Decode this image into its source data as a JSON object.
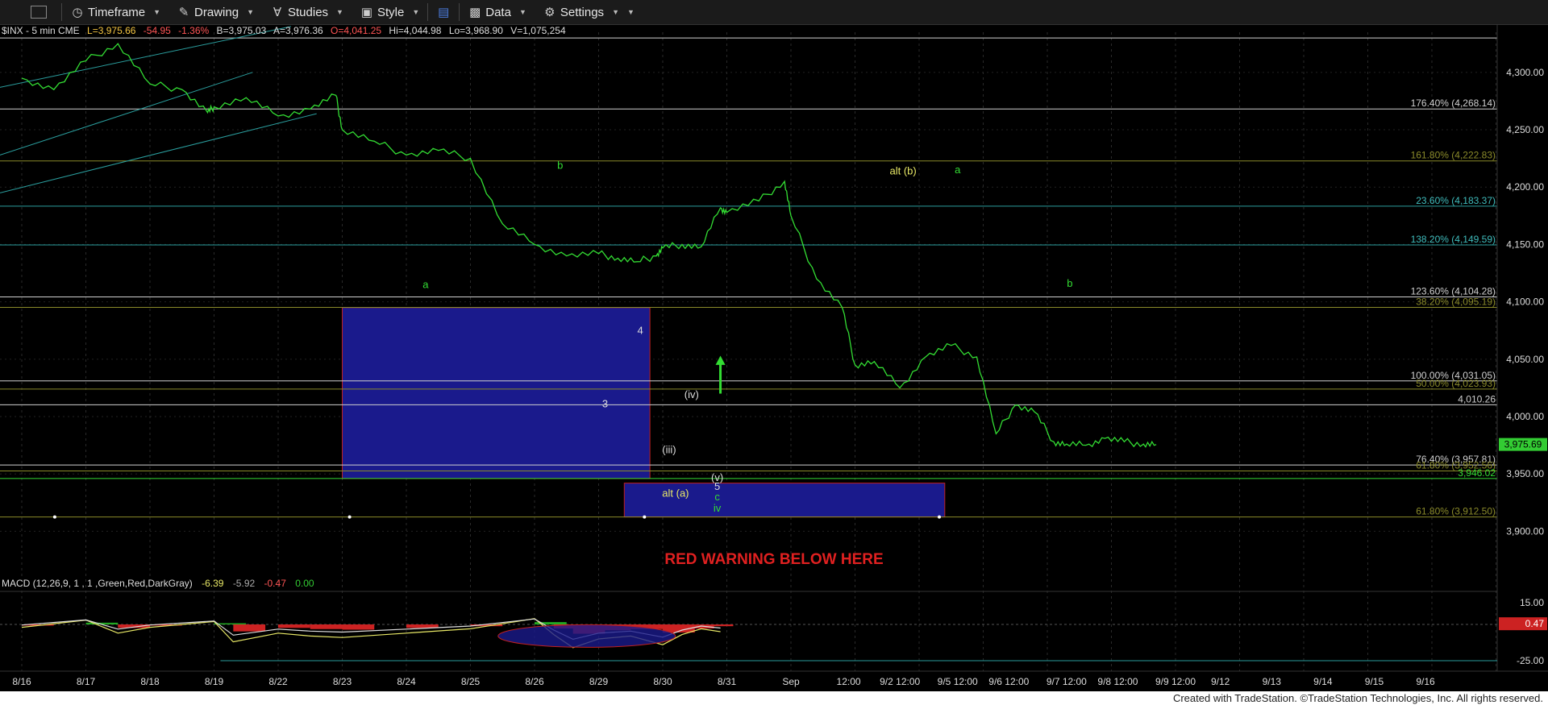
{
  "toolbar": {
    "items": [
      {
        "label": "Timeframe",
        "icon": "clock-icon"
      },
      {
        "label": "Drawing",
        "icon": "pencil-icon"
      },
      {
        "label": "Studies",
        "icon": "studies-icon"
      },
      {
        "label": "Style",
        "icon": "style-icon"
      },
      {
        "label": "Data",
        "icon": "data-icon"
      },
      {
        "label": "Settings",
        "icon": "gear-icon"
      }
    ]
  },
  "header": {
    "symbol": "$INX - 5 min  CME",
    "last": "L=3,975.66",
    "change": "-54.95",
    "pct": "-1.36%",
    "bid": "B=3,975.03",
    "ask": "A=3,976.36",
    "open": "O=4,041.25",
    "hi": "Hi=4,044.98",
    "lo": "Lo=3,968.90",
    "volume": "V=1,075,254"
  },
  "macd_header": {
    "name": "MACD (12,26,9, 1 , 1 ,Green,Red,DarkGray)",
    "v1": "-6.39",
    "v2": "-5.92",
    "v3": "-0.47",
    "v4": "0.00"
  },
  "colors": {
    "price": "#33dd33",
    "teal": "#2a9d9d",
    "white_level": "#cfcfcf",
    "olive": "#8a8a2a",
    "box": "#1a1a8c",
    "warning": "#e02020",
    "last_badge": "#33cc33",
    "macd_badge": "#cc2222"
  },
  "chart_data": {
    "type": "line",
    "title": "",
    "xlabel": "",
    "ylabel": "",
    "ylim": [
      3875,
      4335
    ],
    "x_ticks": [
      "8/16",
      "8/17",
      "8/18",
      "8/19",
      "8/22",
      "8/23",
      "8/24",
      "8/25",
      "8/26",
      "8/29",
      "8/30",
      "8/31",
      "Sep",
      "12:00",
      "9/2 12:00",
      "9/5 12:00",
      "9/6 12:00",
      "9/7 12:00",
      "9/8 12:00",
      "9/9 12:00",
      "9/12",
      "9/13",
      "9/14",
      "9/15",
      "9/16"
    ],
    "y_ticks": [
      "4,300.00",
      "4,250.00",
      "4,200.00",
      "4,150.00",
      "4,100.00",
      "4,050.00",
      "4,000.00",
      "3,950.00",
      "3,900.00"
    ],
    "series": [
      {
        "name": "$INX",
        "x": [
          0,
          0.5,
          1,
          1.5,
          2,
          2.5,
          2.9,
          3,
          3.5,
          4,
          4.5,
          4.9,
          5,
          5.5,
          6,
          6.5,
          7,
          7.5,
          8,
          8.5,
          9,
          9.3,
          9.6,
          9.9,
          10,
          10.3,
          10.6,
          10.9,
          11,
          11.5,
          11.9,
          12,
          12.4,
          12.8,
          13,
          13.3,
          13.7,
          14.1,
          14.5,
          14.9,
          15.2,
          15.5,
          15.8,
          16.1,
          16.3,
          16.6,
          16.9,
          17.2,
          17.5,
          17.7
        ],
        "y": [
          4295,
          4285,
          4310,
          4325,
          4290,
          4285,
          4265,
          4270,
          4278,
          4262,
          4268,
          4280,
          4250,
          4240,
          4228,
          4232,
          4225,
          4168,
          4150,
          4140,
          4142,
          4138,
          4135,
          4140,
          4147,
          4150,
          4148,
          4182,
          4178,
          4188,
          4205,
          4175,
          4120,
          4095,
          4045,
          4048,
          4025,
          4052,
          4062,
          4052,
          3985,
          4010,
          4004,
          3978,
          3976,
          3975,
          3981,
          3978,
          3976,
          3975.66
        ]
      }
    ],
    "levels": [
      {
        "label": "176.40% (4,268.14)",
        "value": 4268.14,
        "color": "white"
      },
      {
        "label": "161.80% (4,222.83)",
        "value": 4222.83,
        "color": "olive"
      },
      {
        "label": "23.60% (4,183.37)",
        "value": 4183.37,
        "color": "teal"
      },
      {
        "label": "138.20% (4,149.59)",
        "value": 4149.59,
        "color": "teal"
      },
      {
        "label": "123.60% (4,104.28)",
        "value": 4104.28,
        "color": "white"
      },
      {
        "label": "38.20% (4,095.19)",
        "value": 4095.19,
        "color": "olive"
      },
      {
        "label": "100.00% (4,031.05)",
        "value": 4031.05,
        "color": "white"
      },
      {
        "label": "50.00% (4,023.93)",
        "value": 4023.93,
        "color": "olive"
      },
      {
        "label": "4,010.26",
        "value": 4010.26,
        "color": "white"
      },
      {
        "label": "76.40% (3,957.81)",
        "value": 3957.81,
        "color": "white"
      },
      {
        "label": "61.80% (3,952.56)",
        "value": 3952.56,
        "color": "olive"
      },
      {
        "label": "3,946.02",
        "value": 3946.02,
        "color": "green"
      },
      {
        "label": "61.80% (3,912.50)",
        "value": 3912.5,
        "color": "olive"
      }
    ],
    "last_price": "3,975.69",
    "annotations": [
      {
        "text": "a",
        "x": 6.3,
        "y": 4112,
        "color": "green"
      },
      {
        "text": "b",
        "x": 8.4,
        "y": 4216,
        "color": "green"
      },
      {
        "text": "3",
        "x": 9.1,
        "y": 4008,
        "color": "white"
      },
      {
        "text": "4",
        "x": 9.65,
        "y": 4072,
        "color": "white"
      },
      {
        "text": "(iv)",
        "x": 10.45,
        "y": 4016,
        "color": "white"
      },
      {
        "text": "(iii)",
        "x": 10.1,
        "y": 3968,
        "color": "white"
      },
      {
        "text": "(v)",
        "x": 10.85,
        "y": 3944,
        "color": "white"
      },
      {
        "text": "5",
        "x": 10.85,
        "y": 3936,
        "color": "white"
      },
      {
        "text": "c",
        "x": 10.85,
        "y": 3927,
        "color": "green"
      },
      {
        "text": "iv",
        "x": 10.85,
        "y": 3917,
        "color": "green"
      },
      {
        "text": "alt (a)",
        "x": 10.2,
        "y": 3930,
        "color": "yellow"
      },
      {
        "text": "alt (b)",
        "x": 13.75,
        "y": 4211,
        "color": "yellow"
      },
      {
        "text": "a",
        "x": 14.6,
        "y": 4212,
        "color": "green"
      },
      {
        "text": "b",
        "x": 16.35,
        "y": 4113,
        "color": "green"
      }
    ],
    "warning_text": "RED WARNING BELOW HERE",
    "macd": {
      "y_ticks": [
        "15.00",
        "0.47",
        "-25.00"
      ],
      "macd_x": [
        0,
        1,
        1.5,
        2,
        3,
        3.3,
        4,
        4.5,
        5,
        6,
        7,
        8,
        8.3,
        8.6,
        9,
        9.5,
        10,
        10.3,
        10.6,
        10.9
      ],
      "macd_y": [
        -2,
        3,
        -6,
        -2,
        2,
        -12,
        -6,
        -8,
        -9,
        -6,
        -3,
        4,
        -7,
        -16,
        -10,
        -8,
        -14,
        -7,
        -3,
        -5
      ]
    },
    "footer": "Created with TradeStation. ©TradeStation Technologies, Inc. All rights reserved."
  }
}
